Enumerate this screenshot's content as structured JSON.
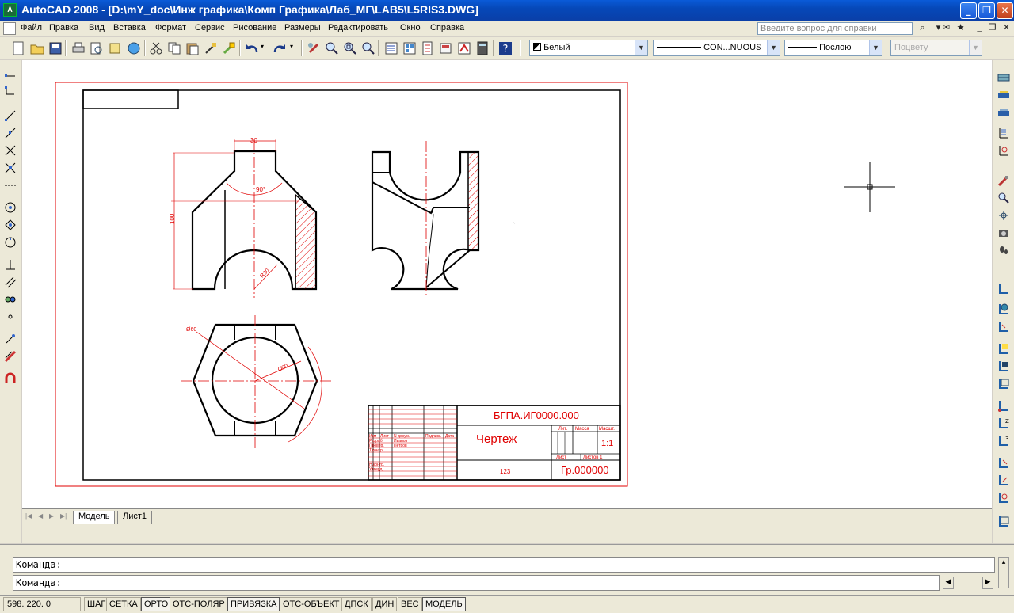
{
  "window": {
    "title": "AutoCAD 2008 - [D:\\mY_doc\\Инж графика\\Комп Графика\\Лаб_МГ\\LAB5\\L5RIS3.DWG]",
    "buttons": [
      "_",
      "❐",
      "✕"
    ]
  },
  "menu": {
    "items": [
      "Файл",
      "Правка",
      "Вид",
      "Вставка",
      "Формат",
      "Сервис",
      "Рисование",
      "Размеры",
      "Редактировать",
      "Окно",
      "Справка"
    ],
    "help_placeholder": "Введите вопрос для справки"
  },
  "toolbar": {
    "color_combo": "Белый",
    "linetype_combo": "CON...NUOUS",
    "lineweight_combo": "Послою",
    "plotstyle_combo": "Поцвету"
  },
  "drawing": {
    "dim_30": "30",
    "dim_90deg": "90°",
    "dim_100": "100",
    "dim_r30": "R30",
    "dim_d60": "Ø60",
    "dim_d80": "Ø80",
    "title_block": {
      "designation": "БГПА.ИГ0000.000",
      "name": "Чертеж",
      "scale": "1:1",
      "group": "Гр.000000",
      "number": "123",
      "lit": "Лит.",
      "mass": "Масса",
      "masshtab": "Масшт.",
      "sheet": "Лист",
      "sheets": "Листов 1",
      "row_labels": [
        "Изм",
        "Лист",
        "N докум.",
        "Подпись",
        "Дата"
      ],
      "roles": [
        "Разраб.",
        "Провер.",
        "Т.контр.",
        "Н.контр.",
        "Утверд."
      ],
      "names": [
        "Иванов",
        "Петров"
      ]
    }
  },
  "tabs": {
    "model": "Модель",
    "sheet1": "Лист1"
  },
  "command": {
    "line1": "Команда:",
    "line2": "Команда:"
  },
  "status": {
    "coords": "598. 220. 0",
    "buttons": [
      "ШАГ",
      "СЕТКА",
      "ОРТО",
      "ОТС-ПОЛЯР",
      "ПРИВЯЗКА",
      "ОТС-ОБЪЕКТ",
      "ДПСК",
      "ДИН",
      "ВЕС",
      "МОДЕЛЬ"
    ],
    "on": [
      false,
      false,
      true,
      false,
      true,
      false,
      false,
      false,
      false,
      true
    ]
  },
  "colors": {
    "frame_red": "#e00000",
    "line_black": "#000000"
  }
}
